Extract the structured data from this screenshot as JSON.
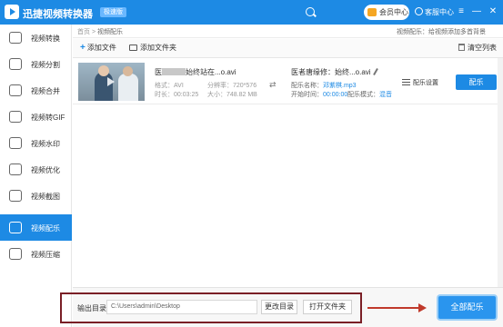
{
  "app": {
    "title": "迅捷视频转换器",
    "badge": "极速版",
    "member_label": "会员中心",
    "support_label": "客服中心",
    "win_menu": "≡",
    "win_min": "—",
    "win_close": "✕"
  },
  "sidebar": {
    "items": [
      {
        "label": "视频转换",
        "icon": "convert-icon"
      },
      {
        "label": "视频分割",
        "icon": "split-icon"
      },
      {
        "label": "视频合并",
        "icon": "merge-icon"
      },
      {
        "label": "视频转GIF",
        "icon": "gif-icon"
      },
      {
        "label": "视频水印",
        "icon": "watermark-icon"
      },
      {
        "label": "视频优化",
        "icon": "optimize-icon"
      },
      {
        "label": "视频截图",
        "icon": "screenshot-icon"
      },
      {
        "label": "视频配乐",
        "icon": "music-icon",
        "active": true
      },
      {
        "label": "视频压缩",
        "icon": "compress-icon"
      }
    ]
  },
  "breadcrumb": {
    "home": "首页",
    "separator": ">",
    "current": "视频配乐",
    "tip": "视频配乐：给视频添加多首背景"
  },
  "toolbar": {
    "add_file": "添加文件",
    "add_folder": "添加文件夹",
    "clear_list": "清空列表"
  },
  "file": {
    "name_prefix": "医",
    "name_suffix": "始终站在...o.avi",
    "format_label": "格式：",
    "format_value": "AVI",
    "duration_label": "时长：",
    "duration_value": "00:03:25",
    "resolution_label": "分辨率：",
    "resolution_value": "720*576",
    "size_label": "大小：",
    "size_value": "748.82 MB",
    "output_name": "医者唐缘修：始终...o.avi",
    "music_label": "配乐名称：",
    "music_value": "邓紫棋.mp3",
    "start_label": "开始时间：",
    "start_value": "00:00:00",
    "mode_label": "配乐模式：",
    "mode_value": "混音",
    "settings_label": "配乐设置",
    "mix_button": "配乐"
  },
  "footer": {
    "output_label": "输出目录",
    "output_path": "C:\\Users\\admin\\Desktop",
    "change_dir": "更改目录",
    "open_folder": "打开文件夹",
    "all_mix": "全部配乐"
  },
  "colors": {
    "brand": "#1d8ae4",
    "highlight_box": "#7a1f26",
    "arrow": "#c0392b"
  }
}
